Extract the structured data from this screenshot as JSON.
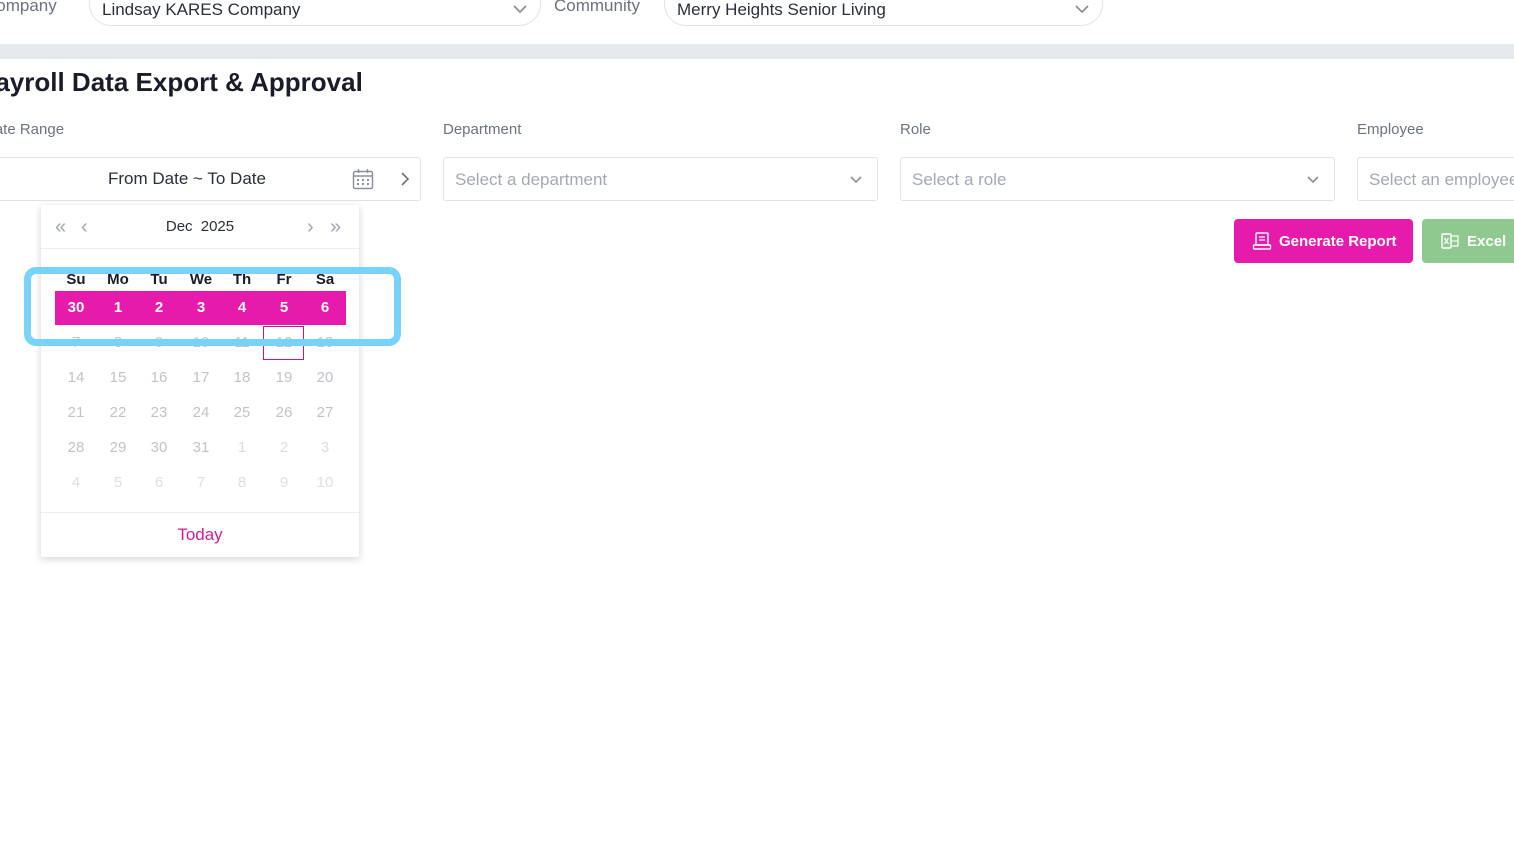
{
  "filters_top": {
    "company_label": "Company",
    "company_value": "Lindsay KARES Company",
    "community_label": "Community",
    "community_value": "Merry Heights Senior Living"
  },
  "page": {
    "title": "Payroll Data Export & Approval"
  },
  "fields": {
    "date_range_label": "Date Range",
    "date_range_value": "From Date ~ To Date",
    "department_label": "Department",
    "department_placeholder": "Select a department",
    "role_label": "Role",
    "role_placeholder": "Select a role",
    "employee_label": "Employee",
    "employee_placeholder": "Select an employee"
  },
  "buttons": {
    "generate": "Generate Report",
    "excel": "Excel"
  },
  "calendar": {
    "month": "Dec",
    "year": "2025",
    "weekdays": [
      "Su",
      "Mo",
      "Tu",
      "We",
      "Th",
      "Fr",
      "Sa"
    ],
    "weeks": [
      [
        "30",
        "1",
        "2",
        "3",
        "4",
        "5",
        "6"
      ],
      [
        "7",
        "8",
        "9",
        "10",
        "11",
        "12",
        "13"
      ],
      [
        "14",
        "15",
        "16",
        "17",
        "18",
        "19",
        "20"
      ],
      [
        "21",
        "22",
        "23",
        "24",
        "25",
        "26",
        "27"
      ],
      [
        "28",
        "29",
        "30",
        "31",
        "1",
        "2",
        "3"
      ],
      [
        "4",
        "5",
        "6",
        "7",
        "8",
        "9",
        "10"
      ]
    ],
    "today_label": "Today"
  },
  "colors": {
    "accent": "#e61bab",
    "excel": "#8fc98f",
    "highlight": "#78d3fb"
  }
}
